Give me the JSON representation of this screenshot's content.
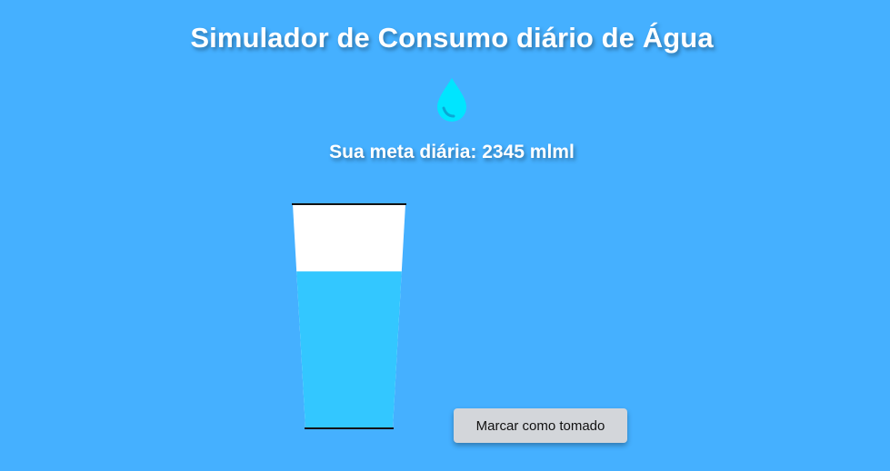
{
  "header": {
    "title": "Simulador de Consumo diário de Água"
  },
  "icon": {
    "name": "water-drop-icon",
    "color": "#00e5ff"
  },
  "goal": {
    "text": "Sua meta diária: 2345 mlml"
  },
  "cup": {
    "fill_fraction": 0.7,
    "water_color": "#33c7ff",
    "empty_color": "#ffffff"
  },
  "actions": {
    "mark_label": "Marcar como tomado"
  },
  "colors": {
    "background": "#45b0ff",
    "button": "#d3d6da"
  }
}
